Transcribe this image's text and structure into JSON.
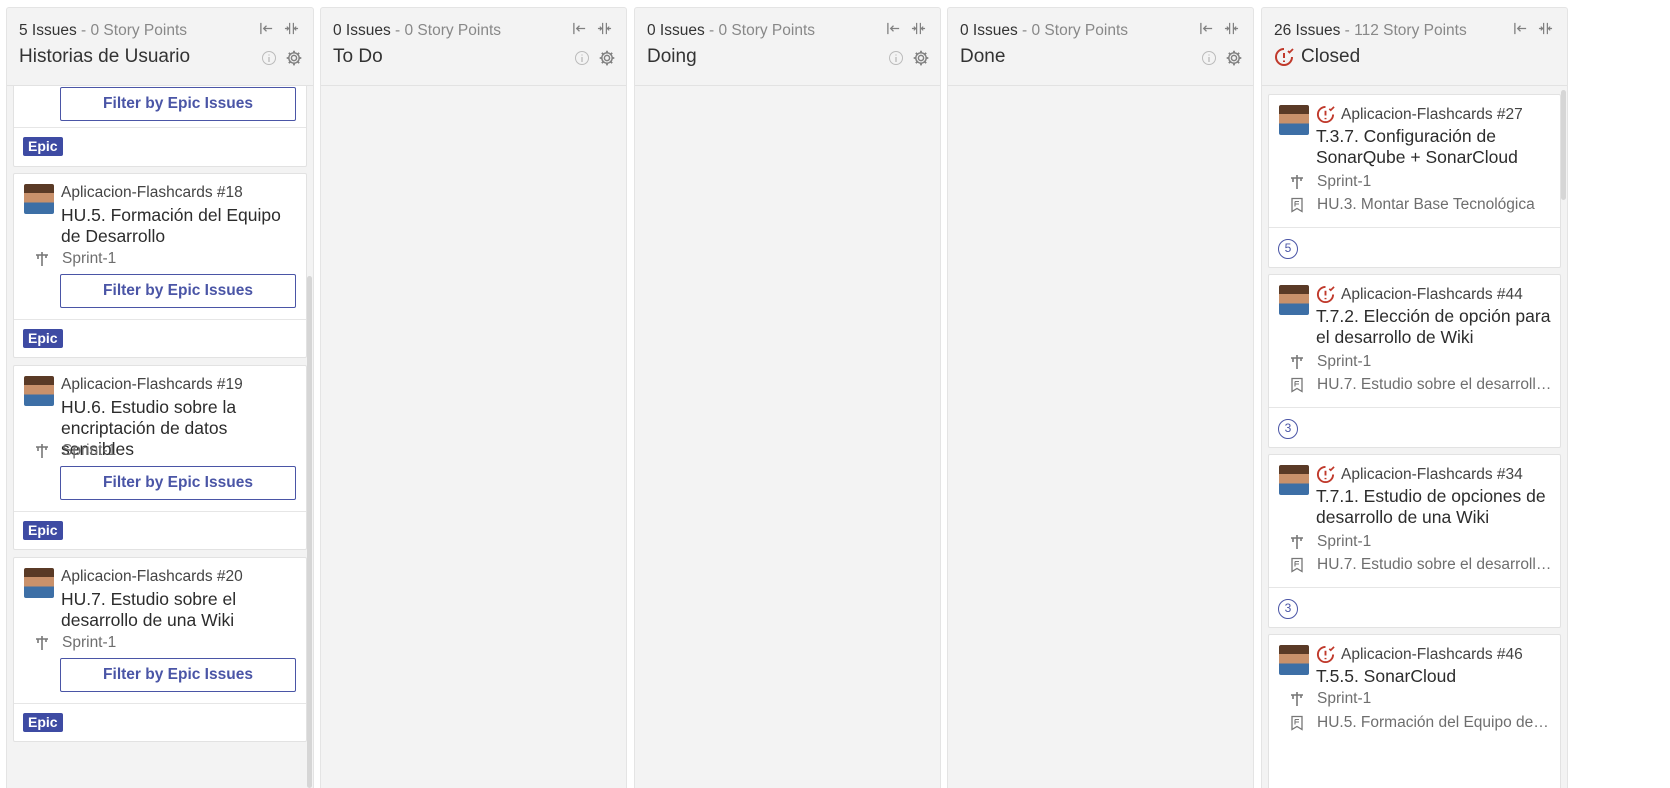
{
  "columns": [
    {
      "issues": "5 Issues",
      "points": " - 0 Story Points",
      "title": "Historias de Usuario"
    },
    {
      "issues": "0 Issues",
      "points": " - 0 Story Points",
      "title": "To Do"
    },
    {
      "issues": "0 Issues",
      "points": " - 0 Story Points",
      "title": "Doing"
    },
    {
      "issues": "0 Issues",
      "points": " - 0 Story Points",
      "title": "Done"
    },
    {
      "issues": "26 Issues",
      "points": " - 112 Story Points",
      "title": "Closed"
    }
  ],
  "left_cards": [
    {
      "filter": "Filter by Epic Issues",
      "badge": "Epic"
    },
    {
      "ref": "Aplicacion-Flashcards #18",
      "title": "HU.5. Formación del Equipo de Desarrollo",
      "sprint": "Sprint-1",
      "filter": "Filter by Epic Issues",
      "badge": "Epic"
    },
    {
      "ref": "Aplicacion-Flashcards #19",
      "title": "HU.6. Estudio sobre la encriptación de datos sensibles",
      "sprint": "Sprint-1",
      "filter": "Filter by Epic Issues",
      "badge": "Epic"
    },
    {
      "ref": "Aplicacion-Flashcards #20",
      "title": "HU.7. Estudio sobre el desarrollo de una Wiki",
      "sprint": "Sprint-1",
      "filter": "Filter by Epic Issues",
      "badge": "Epic"
    }
  ],
  "closed_cards": [
    {
      "ref": "Aplicacion-Flashcards #27",
      "title": "T.3.7. Configuración de SonarQube + SonarCloud",
      "sprint": "Sprint-1",
      "epic": "HU.3. Montar Base Tecnológica",
      "points": "5"
    },
    {
      "ref": "Aplicacion-Flashcards #44",
      "title": "T.7.2. Elección de opción para el desarrollo de Wiki",
      "sprint": "Sprint-1",
      "epic": "HU.7. Estudio sobre el desarrollo ...",
      "points": "3"
    },
    {
      "ref": "Aplicacion-Flashcards #34",
      "title": "T.7.1. Estudio de opciones de desarrollo de una Wiki",
      "sprint": "Sprint-1",
      "epic": "HU.7. Estudio sobre el desarrollo ...",
      "points": "3"
    },
    {
      "ref": "Aplicacion-Flashcards #46",
      "title": "T.5.5. SonarCloud",
      "sprint": "Sprint-1",
      "epic": "HU.5. Formación del Equipo de D..."
    }
  ],
  "icons": {
    "collapse": "collapse-left-icon",
    "merge": "merge-columns-icon",
    "info": "info-icon",
    "settings": "gear-icon",
    "sprint": "signpost-icon",
    "epic": "epic-bookmark-icon",
    "closed_status": "closed-issue-icon"
  },
  "colors": {
    "accent": "#4a55a6",
    "epic_badge": "#3e4ba3",
    "closed_icon": "#c0392b"
  }
}
